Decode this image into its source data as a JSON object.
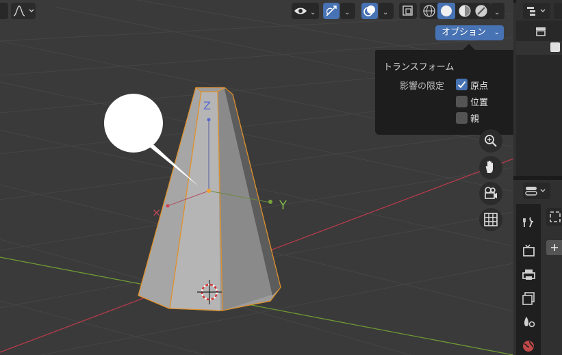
{
  "header": {
    "options_label": "オプション",
    "chevron": "⌄"
  },
  "options_popup": {
    "title": "トランスフォーム",
    "affect_only_label": "影響の限定",
    "checkboxes": [
      {
        "label": "原点",
        "checked": true
      },
      {
        "label": "位置",
        "checked": false
      },
      {
        "label": "親",
        "checked": false
      }
    ]
  },
  "viewport": {
    "y_axis_label": "Y",
    "z_axis_label": "Z"
  },
  "icons": {
    "visibility": "eye-icon",
    "gizmo": "gizmo-icon",
    "overlay": "overlay-icon",
    "xray": "xray-icon",
    "shading": [
      "wireframe-icon",
      "solid-icon",
      "material-icon",
      "rendered-icon"
    ],
    "navigation": [
      "zoom-icon",
      "hand-icon",
      "camera-icon",
      "grid-icon"
    ],
    "properties_tabs": [
      "tool-icon",
      "render-icon",
      "output-icon",
      "view-layer-icon",
      "scene-icon",
      "world-icon"
    ]
  },
  "colors": {
    "accent": "#4772b3",
    "selection_outline": "#f0a030",
    "x_axis": "#c83a4a",
    "y_axis": "#7aa53c"
  }
}
